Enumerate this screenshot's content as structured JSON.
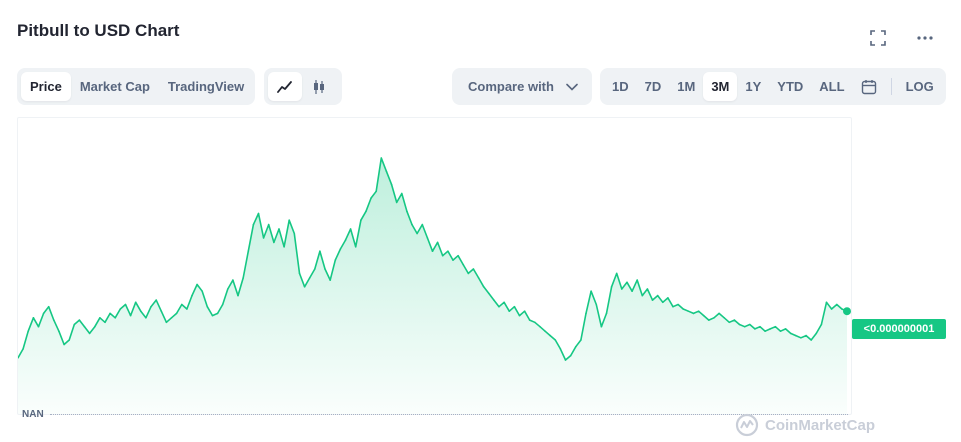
{
  "header": {
    "title": "Pitbull to USD Chart"
  },
  "icons": {
    "fullscreen": "fullscreen-icon",
    "more": "more-icon",
    "line": "line-chart-icon",
    "candle": "candlestick-icon",
    "chevron": "chevron-down-icon",
    "calendar": "calendar-icon",
    "logo": "coinmarketcap-logo-icon"
  },
  "chart_type_tabs": [
    {
      "label": "Price",
      "active": true
    },
    {
      "label": "Market Cap",
      "active": false
    },
    {
      "label": "TradingView",
      "active": false
    }
  ],
  "compare": {
    "label": "Compare with"
  },
  "ranges": [
    {
      "label": "1D",
      "active": false
    },
    {
      "label": "7D",
      "active": false
    },
    {
      "label": "1M",
      "active": false
    },
    {
      "label": "3M",
      "active": true
    },
    {
      "label": "1Y",
      "active": false
    },
    {
      "label": "YTD",
      "active": false
    },
    {
      "label": "ALL",
      "active": false
    }
  ],
  "log_label": "LOG",
  "price_tag": "<0.000000001",
  "axis": {
    "baseline_label": "NAN"
  },
  "watermark": "CoinMarketCap",
  "colors": {
    "accent": "#16c784",
    "text": "#222531",
    "muted": "#58667e",
    "control_bg": "#eff2f5"
  },
  "chart_data": {
    "type": "area",
    "title": "",
    "xlabel": "",
    "ylabel": "",
    "grid": false,
    "series": [
      {
        "values": [
          0.1,
          0.14,
          0.22,
          0.28,
          0.24,
          0.3,
          0.33,
          0.27,
          0.22,
          0.16,
          0.18,
          0.25,
          0.27,
          0.24,
          0.21,
          0.24,
          0.28,
          0.26,
          0.3,
          0.28,
          0.32,
          0.34,
          0.29,
          0.35,
          0.31,
          0.28,
          0.33,
          0.36,
          0.31,
          0.26,
          0.28,
          0.3,
          0.34,
          0.32,
          0.38,
          0.43,
          0.4,
          0.33,
          0.29,
          0.3,
          0.34,
          0.41,
          0.45,
          0.38,
          0.46,
          0.58,
          0.7,
          0.75,
          0.64,
          0.7,
          0.62,
          0.68,
          0.6,
          0.72,
          0.66,
          0.48,
          0.42,
          0.46,
          0.5,
          0.58,
          0.5,
          0.45,
          0.54,
          0.59,
          0.63,
          0.68,
          0.6,
          0.72,
          0.76,
          0.82,
          0.85,
          1.0,
          0.94,
          0.88,
          0.8,
          0.84,
          0.76,
          0.7,
          0.66,
          0.7,
          0.64,
          0.58,
          0.62,
          0.56,
          0.58,
          0.54,
          0.56,
          0.52,
          0.48,
          0.5,
          0.46,
          0.42,
          0.39,
          0.36,
          0.33,
          0.35,
          0.31,
          0.33,
          0.29,
          0.31,
          0.27,
          0.26,
          0.24,
          0.22,
          0.2,
          0.18,
          0.14,
          0.09,
          0.11,
          0.15,
          0.18,
          0.3,
          0.4,
          0.34,
          0.24,
          0.3,
          0.42,
          0.48,
          0.41,
          0.44,
          0.4,
          0.45,
          0.38,
          0.41,
          0.36,
          0.38,
          0.35,
          0.37,
          0.33,
          0.34,
          0.32,
          0.31,
          0.3,
          0.31,
          0.29,
          0.27,
          0.28,
          0.3,
          0.28,
          0.26,
          0.27,
          0.25,
          0.24,
          0.25,
          0.23,
          0.24,
          0.22,
          0.23,
          0.24,
          0.22,
          0.23,
          0.21,
          0.2,
          0.19,
          0.2,
          0.18,
          0.21,
          0.25,
          0.35,
          0.32,
          0.34,
          0.32,
          0.31
        ]
      }
    ],
    "y_range": [
      0,
      1
    ],
    "last_value_label": "<0.000000001",
    "selected_range": "3M"
  }
}
